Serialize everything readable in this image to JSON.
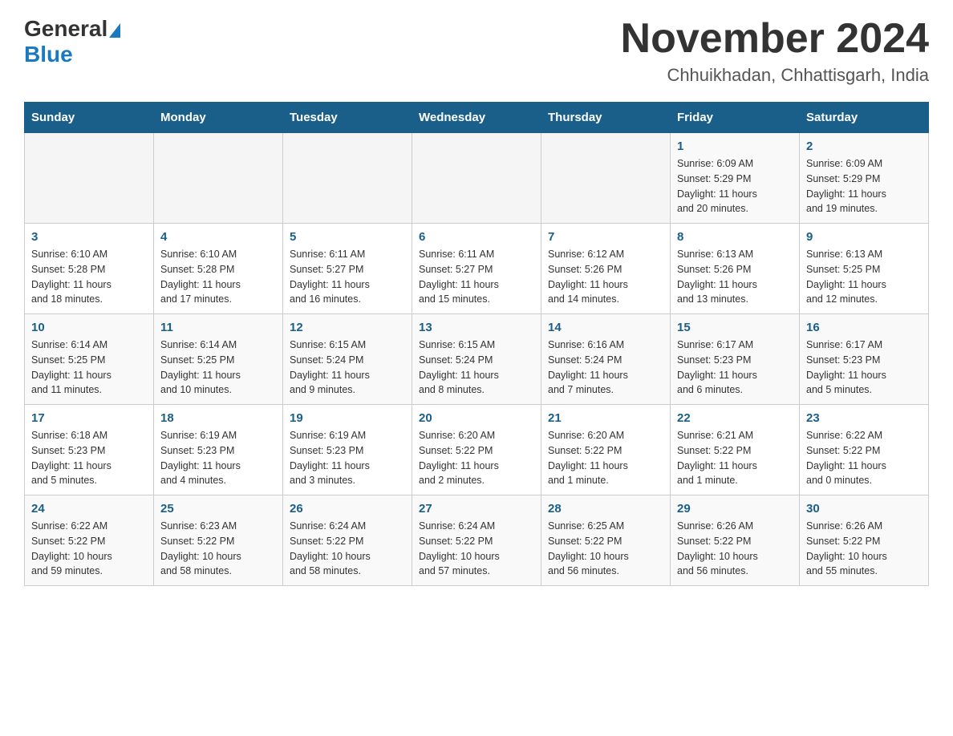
{
  "header": {
    "logo": {
      "part1": "General",
      "part2": "Blue"
    },
    "title": "November 2024",
    "location": "Chhuikhadan, Chhattisgarh, India"
  },
  "calendar": {
    "days_of_week": [
      "Sunday",
      "Monday",
      "Tuesday",
      "Wednesday",
      "Thursday",
      "Friday",
      "Saturday"
    ],
    "weeks": [
      {
        "cells": [
          {
            "day": "",
            "info": ""
          },
          {
            "day": "",
            "info": ""
          },
          {
            "day": "",
            "info": ""
          },
          {
            "day": "",
            "info": ""
          },
          {
            "day": "",
            "info": ""
          },
          {
            "day": "1",
            "info": "Sunrise: 6:09 AM\nSunset: 5:29 PM\nDaylight: 11 hours\nand 20 minutes."
          },
          {
            "day": "2",
            "info": "Sunrise: 6:09 AM\nSunset: 5:29 PM\nDaylight: 11 hours\nand 19 minutes."
          }
        ]
      },
      {
        "cells": [
          {
            "day": "3",
            "info": "Sunrise: 6:10 AM\nSunset: 5:28 PM\nDaylight: 11 hours\nand 18 minutes."
          },
          {
            "day": "4",
            "info": "Sunrise: 6:10 AM\nSunset: 5:28 PM\nDaylight: 11 hours\nand 17 minutes."
          },
          {
            "day": "5",
            "info": "Sunrise: 6:11 AM\nSunset: 5:27 PM\nDaylight: 11 hours\nand 16 minutes."
          },
          {
            "day": "6",
            "info": "Sunrise: 6:11 AM\nSunset: 5:27 PM\nDaylight: 11 hours\nand 15 minutes."
          },
          {
            "day": "7",
            "info": "Sunrise: 6:12 AM\nSunset: 5:26 PM\nDaylight: 11 hours\nand 14 minutes."
          },
          {
            "day": "8",
            "info": "Sunrise: 6:13 AM\nSunset: 5:26 PM\nDaylight: 11 hours\nand 13 minutes."
          },
          {
            "day": "9",
            "info": "Sunrise: 6:13 AM\nSunset: 5:25 PM\nDaylight: 11 hours\nand 12 minutes."
          }
        ]
      },
      {
        "cells": [
          {
            "day": "10",
            "info": "Sunrise: 6:14 AM\nSunset: 5:25 PM\nDaylight: 11 hours\nand 11 minutes."
          },
          {
            "day": "11",
            "info": "Sunrise: 6:14 AM\nSunset: 5:25 PM\nDaylight: 11 hours\nand 10 minutes."
          },
          {
            "day": "12",
            "info": "Sunrise: 6:15 AM\nSunset: 5:24 PM\nDaylight: 11 hours\nand 9 minutes."
          },
          {
            "day": "13",
            "info": "Sunrise: 6:15 AM\nSunset: 5:24 PM\nDaylight: 11 hours\nand 8 minutes."
          },
          {
            "day": "14",
            "info": "Sunrise: 6:16 AM\nSunset: 5:24 PM\nDaylight: 11 hours\nand 7 minutes."
          },
          {
            "day": "15",
            "info": "Sunrise: 6:17 AM\nSunset: 5:23 PM\nDaylight: 11 hours\nand 6 minutes."
          },
          {
            "day": "16",
            "info": "Sunrise: 6:17 AM\nSunset: 5:23 PM\nDaylight: 11 hours\nand 5 minutes."
          }
        ]
      },
      {
        "cells": [
          {
            "day": "17",
            "info": "Sunrise: 6:18 AM\nSunset: 5:23 PM\nDaylight: 11 hours\nand 5 minutes."
          },
          {
            "day": "18",
            "info": "Sunrise: 6:19 AM\nSunset: 5:23 PM\nDaylight: 11 hours\nand 4 minutes."
          },
          {
            "day": "19",
            "info": "Sunrise: 6:19 AM\nSunset: 5:23 PM\nDaylight: 11 hours\nand 3 minutes."
          },
          {
            "day": "20",
            "info": "Sunrise: 6:20 AM\nSunset: 5:22 PM\nDaylight: 11 hours\nand 2 minutes."
          },
          {
            "day": "21",
            "info": "Sunrise: 6:20 AM\nSunset: 5:22 PM\nDaylight: 11 hours\nand 1 minute."
          },
          {
            "day": "22",
            "info": "Sunrise: 6:21 AM\nSunset: 5:22 PM\nDaylight: 11 hours\nand 1 minute."
          },
          {
            "day": "23",
            "info": "Sunrise: 6:22 AM\nSunset: 5:22 PM\nDaylight: 11 hours\nand 0 minutes."
          }
        ]
      },
      {
        "cells": [
          {
            "day": "24",
            "info": "Sunrise: 6:22 AM\nSunset: 5:22 PM\nDaylight: 10 hours\nand 59 minutes."
          },
          {
            "day": "25",
            "info": "Sunrise: 6:23 AM\nSunset: 5:22 PM\nDaylight: 10 hours\nand 58 minutes."
          },
          {
            "day": "26",
            "info": "Sunrise: 6:24 AM\nSunset: 5:22 PM\nDaylight: 10 hours\nand 58 minutes."
          },
          {
            "day": "27",
            "info": "Sunrise: 6:24 AM\nSunset: 5:22 PM\nDaylight: 10 hours\nand 57 minutes."
          },
          {
            "day": "28",
            "info": "Sunrise: 6:25 AM\nSunset: 5:22 PM\nDaylight: 10 hours\nand 56 minutes."
          },
          {
            "day": "29",
            "info": "Sunrise: 6:26 AM\nSunset: 5:22 PM\nDaylight: 10 hours\nand 56 minutes."
          },
          {
            "day": "30",
            "info": "Sunrise: 6:26 AM\nSunset: 5:22 PM\nDaylight: 10 hours\nand 55 minutes."
          }
        ]
      }
    ]
  }
}
